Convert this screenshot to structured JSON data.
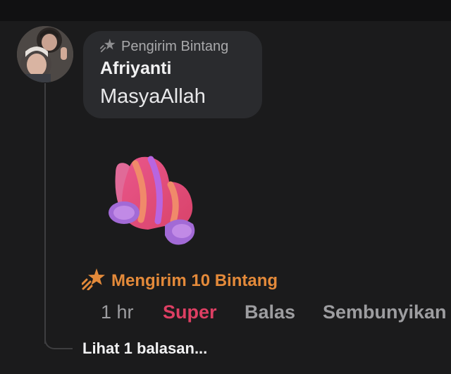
{
  "comment": {
    "badge_label": "Pengirim Bintang",
    "badge_icon": "star-sender-icon",
    "author": "Afriyanti",
    "text": "MasyaAllah",
    "avatar_icon": "user-avatar",
    "sticker_icon": "mitten-glove-sticker"
  },
  "stars": {
    "label": "Mengirim 10 Bintang",
    "icon": "shooting-star-icon",
    "color": "#e48a3a"
  },
  "actions": {
    "time": "1 hr",
    "super": "Super",
    "reply": "Balas",
    "hide": "Sembunyikan",
    "super_color": "#dd3f63"
  },
  "replies": {
    "label": "Lihat 1 balasan..."
  }
}
